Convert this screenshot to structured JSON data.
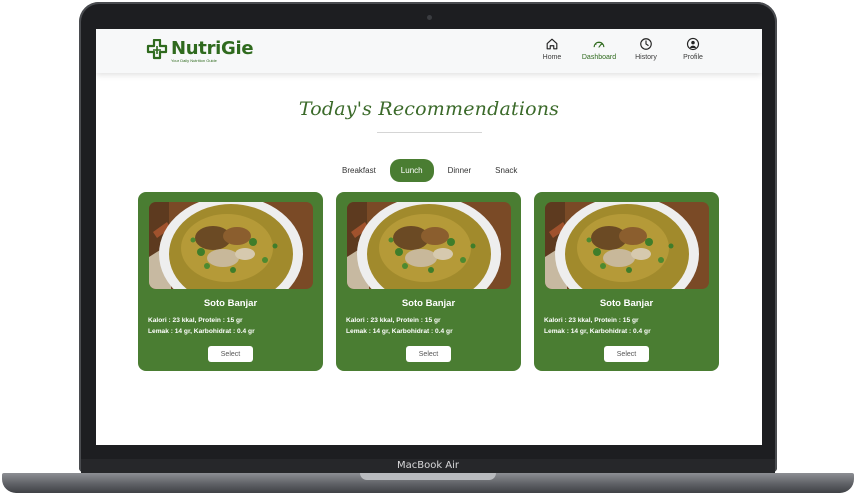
{
  "device": {
    "model": "MacBook Air"
  },
  "brand": {
    "name": "NutriGie",
    "tagline": "Your Daily Nutrition Guide",
    "color": "#2f6a1e"
  },
  "nav": {
    "items": [
      {
        "label": "Home",
        "icon": "home-icon"
      },
      {
        "label": "Dashboard",
        "icon": "gauge-icon",
        "active": true
      },
      {
        "label": "History",
        "icon": "clock-icon"
      },
      {
        "label": "Profile",
        "icon": "user-icon"
      }
    ]
  },
  "page": {
    "title": "Today's Recommendations"
  },
  "tabs": [
    {
      "label": "Breakfast"
    },
    {
      "label": "Lunch",
      "active": true
    },
    {
      "label": "Dinner"
    },
    {
      "label": "Snack"
    }
  ],
  "cards": [
    {
      "name": "Soto Banjar",
      "line1": "Kalori : 23 kkal, Protein : 15 gr",
      "line2": "Lemak : 14 gr, Karbohidrat : 0.4 gr",
      "button": "Select"
    },
    {
      "name": "Soto Banjar",
      "line1": "Kalori : 23 kkal, Protein : 15 gr",
      "line2": "Lemak : 14 gr, Karbohidrat : 0.4 gr",
      "button": "Select"
    },
    {
      "name": "Soto Banjar",
      "line1": "Kalori : 23 kkal, Protein : 15 gr",
      "line2": "Lemak : 14 gr, Karbohidrat : 0.4 gr",
      "button": "Select"
    }
  ],
  "colors": {
    "accent": "#4a7d32",
    "card_bg": "#4a7d32",
    "heading": "#3b6a2a"
  }
}
